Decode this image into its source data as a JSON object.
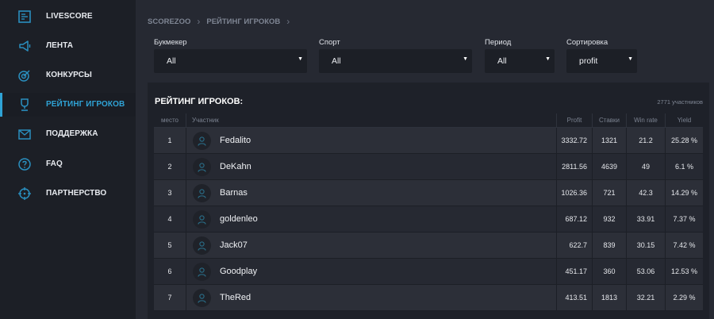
{
  "sidebar": {
    "items": [
      {
        "label": "LIVESCORE",
        "icon": "scoreboard-icon",
        "active": false
      },
      {
        "label": "ЛЕНТА",
        "icon": "megaphone-icon",
        "active": false
      },
      {
        "label": "КОНКУРСЫ",
        "icon": "target-icon",
        "active": false
      },
      {
        "label": "РЕЙТИНГ ИГРОКОВ",
        "icon": "trophy-icon",
        "active": true
      },
      {
        "label": "ПОДДЕРЖКА",
        "icon": "mail-icon",
        "active": false
      },
      {
        "label": "FAQ",
        "icon": "help-icon",
        "active": false
      },
      {
        "label": "ПАРТНЕРСТВО",
        "icon": "crosshair-icon",
        "active": false
      }
    ]
  },
  "breadcrumb": {
    "home": "SCOREZOO",
    "current": "РЕЙТИНГ ИГРОКОВ",
    "separator": "›"
  },
  "filters": {
    "bookmaker": {
      "label": "Букмекер",
      "value": "All"
    },
    "sport": {
      "label": "Спорт",
      "value": "All"
    },
    "period": {
      "label": "Период",
      "value": "All"
    },
    "sort": {
      "label": "Сортировка",
      "value": "profit"
    },
    "arrow": "▼"
  },
  "ranking": {
    "title": "РЕЙТИНГ ИГРОКОВ:",
    "participants": "2771 участников",
    "columns": {
      "place": "место",
      "name": "Участник",
      "profit": "Profit",
      "bets": "Ставки",
      "winrate": "Win rate",
      "yield": "Yield"
    },
    "rows": [
      {
        "place": "1",
        "name": "Fedalito",
        "profit": "3332.72",
        "bets": "1321",
        "winrate": "21.2",
        "yield": "25.28 %"
      },
      {
        "place": "2",
        "name": "DeKahn",
        "profit": "2811.56",
        "bets": "4639",
        "winrate": "49",
        "yield": "6.1 %"
      },
      {
        "place": "3",
        "name": "Barnas",
        "profit": "1026.36",
        "bets": "721",
        "winrate": "42.3",
        "yield": "14.29 %"
      },
      {
        "place": "4",
        "name": "goldenleo",
        "profit": "687.12",
        "bets": "932",
        "winrate": "33.91",
        "yield": "7.37 %"
      },
      {
        "place": "5",
        "name": "Jack07",
        "profit": "622.7",
        "bets": "839",
        "winrate": "30.15",
        "yield": "7.42 %"
      },
      {
        "place": "6",
        "name": "Goodplay",
        "profit": "451.17",
        "bets": "360",
        "winrate": "53.06",
        "yield": "12.53 %"
      },
      {
        "place": "7",
        "name": "TheRed",
        "profit": "413.51",
        "bets": "1813",
        "winrate": "32.21",
        "yield": "2.29 %"
      }
    ]
  },
  "colors": {
    "accent": "#2fa3d6",
    "icon": "#2a8fbf",
    "sidebar_bg": "#1c1f26",
    "page_bg": "#262932"
  }
}
